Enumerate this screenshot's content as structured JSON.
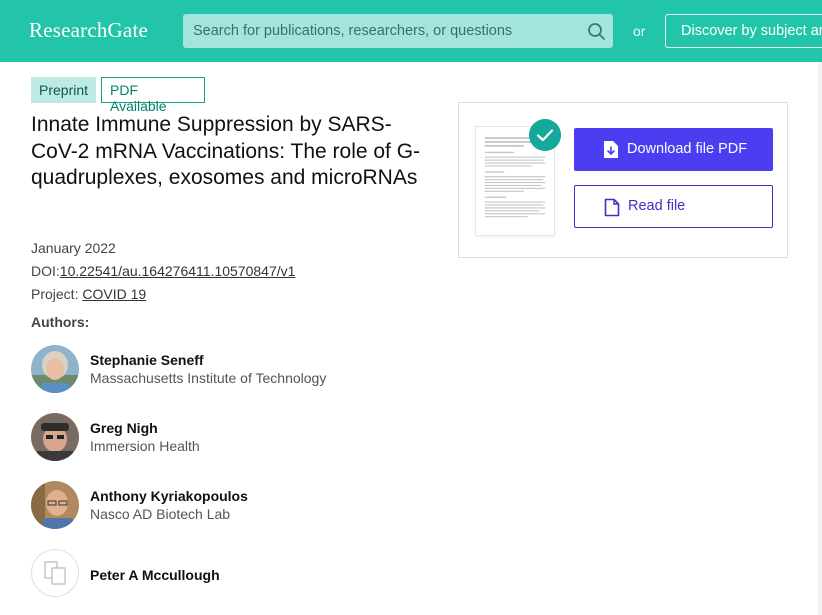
{
  "header": {
    "logo": "ResearchGate",
    "search_placeholder": "Search for publications, researchers, or questions",
    "or_label": "or",
    "discover_label": "Discover by subject area",
    "bg_color": "#22c4aa"
  },
  "badges": {
    "preprint": "Preprint",
    "pdf_available": "PDF Available"
  },
  "publication": {
    "title": "Innate Immune Suppression by SARS-CoV-2 mRNA Vaccinations: The role of G-quadruplexes, exosomes and microRNAs",
    "date": "January 2022",
    "doi_label": "DOI:",
    "doi": "10.22541/au.164276411.10570847/v1",
    "project_label": "Project:",
    "project": "COVID 19",
    "authors_label": "Authors:"
  },
  "authors": [
    {
      "name": "Stephanie Seneff",
      "institution": "Massachusetts Institute of Technology"
    },
    {
      "name": "Greg Nigh",
      "institution": "Immersion Health"
    },
    {
      "name": "Anthony Kyriakopoulos",
      "institution": "Nasco AD Biotech Lab"
    },
    {
      "name": "Peter A Mccullough",
      "institution": ""
    }
  ],
  "download_card": {
    "download_label": "Download file PDF",
    "read_label": "Read file",
    "primary_color": "#4b3ef0",
    "check_color": "#16a89a"
  }
}
